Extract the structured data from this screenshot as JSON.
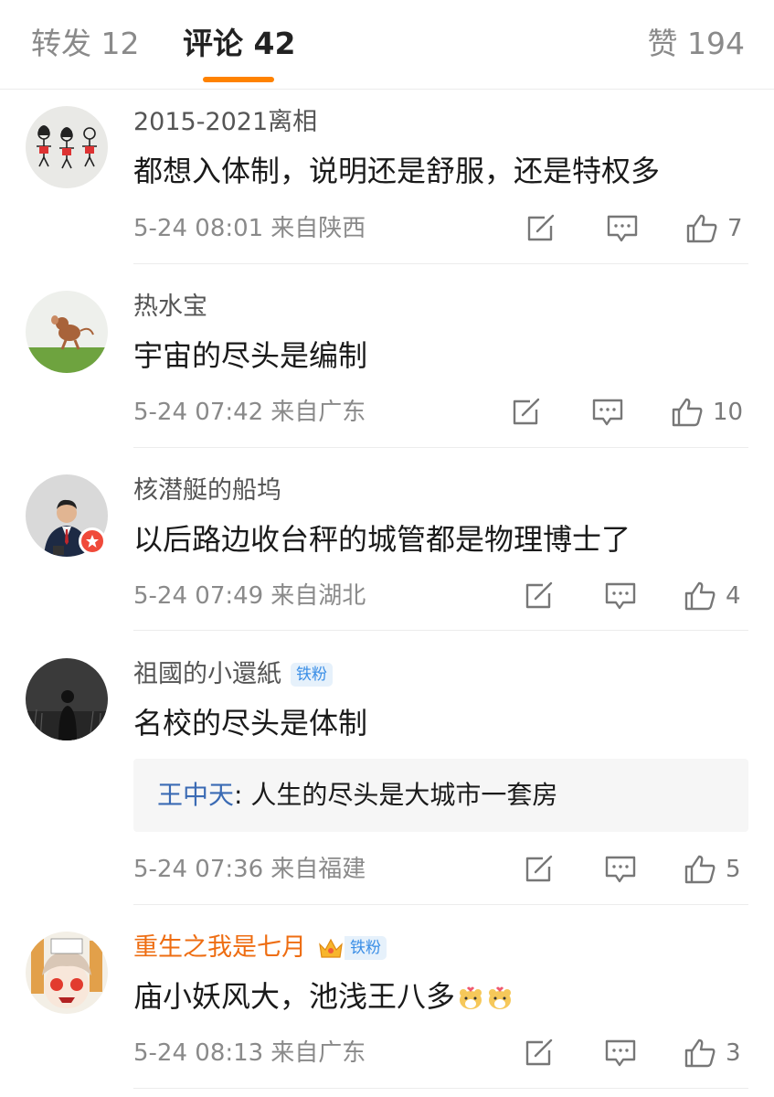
{
  "tabs": {
    "repost": "转发 12",
    "comments": "评论 42",
    "likes": "赞 194"
  },
  "colors": {
    "accent": "#ff8200",
    "vip_name": "#ee6d12",
    "quote_name": "#3b6bb4",
    "fan_badge": "#3a8ee6"
  },
  "comments": [
    {
      "user": "2015-2021离相",
      "text": "都想入体制，说明还是舒服，还是特权多",
      "time": "5-24 08:01",
      "location": "来自陕西",
      "likes": "7"
    },
    {
      "user": "热水宝",
      "text": "宇宙的尽头是编制",
      "time": "5-24 07:42",
      "location": "来自广东",
      "likes": "10"
    },
    {
      "user": "核潜艇的船坞",
      "text": "以后路边收台秤的城管都是物理博士了",
      "time": "5-24 07:49",
      "location": "来自湖北",
      "likes": "4",
      "verified": true
    },
    {
      "user": "祖國的小還紙",
      "badge": "铁粉",
      "text": "名校的尽头是体制",
      "reply": {
        "name": "王中天",
        "sep": ": ",
        "text": "人生的尽头是大城市一套房"
      },
      "time": "5-24 07:36",
      "location": "来自福建",
      "likes": "5"
    },
    {
      "user": "重生之我是七月",
      "badge": "铁粉",
      "text": "庙小妖风大，池浅王八多",
      "emojis": [
        "hamster-emoji",
        "hamster-emoji"
      ],
      "time": "5-24 08:13",
      "location": "来自广东",
      "likes": "3"
    }
  ],
  "icons": {
    "share": "share-icon",
    "comment": "comment-icon",
    "like": "thumbs-up-icon"
  }
}
